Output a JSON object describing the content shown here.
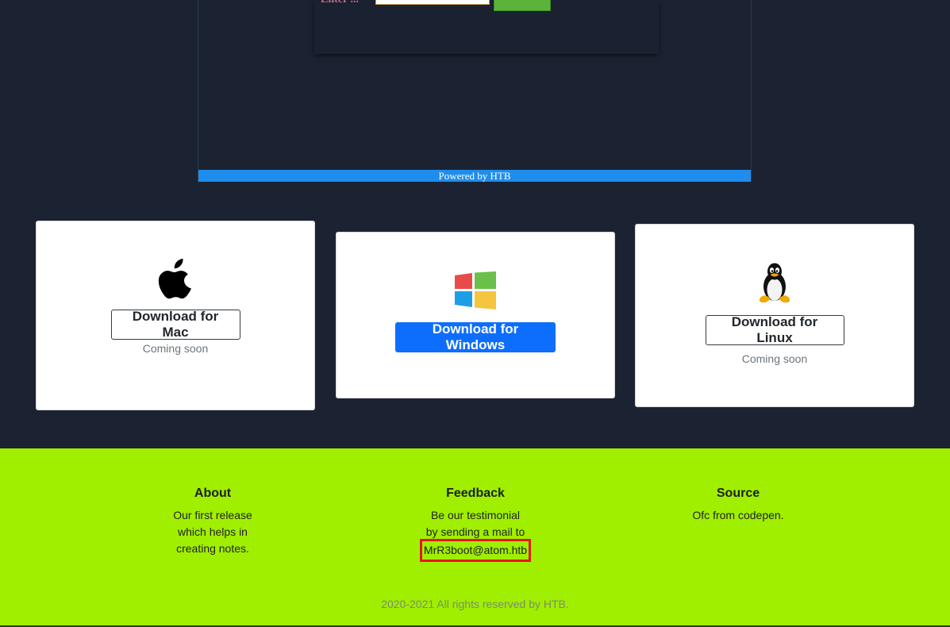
{
  "preview": {
    "label": "Enter ...",
    "powered_by": "Powered by HTB"
  },
  "downloads": {
    "mac": {
      "icon": "apple-icon",
      "button": "Download for Mac",
      "note": "Coming soon"
    },
    "windows": {
      "icon": "windows-icon",
      "button": "Download for Windows"
    },
    "linux": {
      "icon": "linux-tux-icon",
      "button": "Download for Linux",
      "note": "Coming soon"
    }
  },
  "footer": {
    "about": {
      "title": "About",
      "lines": [
        "Our first release",
        "which helps in",
        "creating notes."
      ]
    },
    "feedback": {
      "title": "Feedback",
      "lines": [
        "Be our testimonial",
        "by sending a mail to"
      ],
      "email": "MrR3boot@atom.htb"
    },
    "source": {
      "title": "Source",
      "lines": [
        "Ofc from codepen."
      ]
    },
    "copyright": "2020-2021 All rights reserved by HTB."
  },
  "colors": {
    "page_bg": "#1b2333",
    "footer_bg": "#a0ef00",
    "primary": "#0d6efd",
    "highlight": "#e8151f",
    "powered_bar": "#1f8ded"
  }
}
